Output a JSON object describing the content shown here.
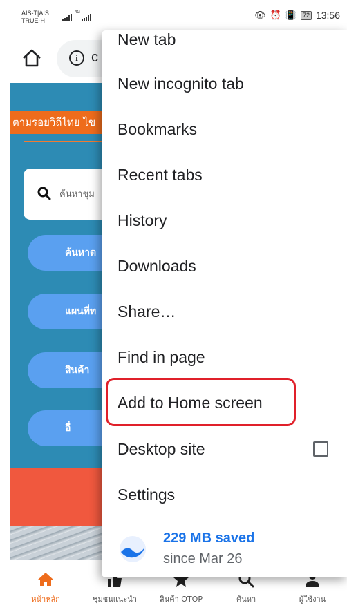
{
  "status_bar": {
    "carrier_line1": "AIS-T|AIS",
    "carrier_line2": "TRUE-H",
    "network_tag": "4G",
    "battery": "72",
    "time": "13:56"
  },
  "browser": {
    "url_partial": "c"
  },
  "menu": {
    "new_tab": "New tab",
    "new_incognito_tab": "New incognito tab",
    "bookmarks": "Bookmarks",
    "recent_tabs": "Recent tabs",
    "history": "History",
    "downloads": "Downloads",
    "share": "Share…",
    "find_in_page": "Find in page",
    "add_to_home_screen": "Add to Home screen",
    "desktop_site": "Desktop site",
    "desktop_site_checked": false,
    "settings": "Settings",
    "data_saved": "229 MB saved",
    "data_saved_since": "since Mar 26"
  },
  "page": {
    "marquee_text": "ตามรอยวิถีไทย  ไข",
    "search_placeholder": "ค้นหาชุม",
    "buttons": [
      "ค้นหาต",
      "แผนที่ท",
      "สินค้า",
      "อื่"
    ]
  },
  "bottom_nav": {
    "items": [
      "หน้าหลัก",
      "ชุมชนแนะนำ",
      "สินค้า OTOP",
      "ค้นหา",
      "ผู้ใช้งาน"
    ],
    "active_index": 0
  },
  "colors": {
    "accent_orange": "#ee6c1c",
    "page_blue": "#2d8bb4",
    "pill_blue": "#5aa0f0",
    "red_band": "#f0583e",
    "highlight_red": "#e0202a",
    "link_blue": "#1a73e8"
  }
}
